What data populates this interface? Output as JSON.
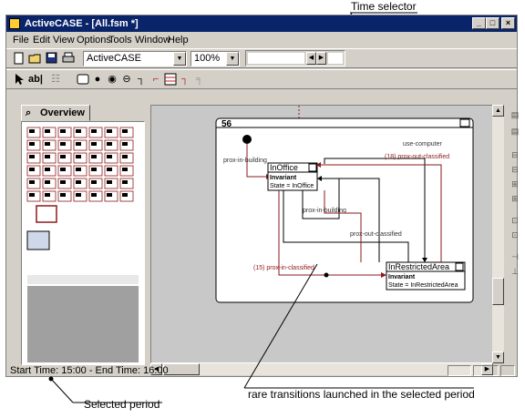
{
  "window": {
    "title": "ActiveCASE - [All.fsm *]",
    "buttons": {
      "minimize": "_",
      "maximize": "□",
      "close": "×"
    }
  },
  "menu": [
    "File",
    "Edit",
    "View",
    "Options",
    "Tools",
    "Window",
    "Help"
  ],
  "toolbar": {
    "project_combo": "ActiveCASE",
    "zoom_combo": "100%",
    "text_tool": "ab|"
  },
  "overview": {
    "tab_label": "Overview"
  },
  "statusbar": {
    "text": "Start Time: 15:00 - End Time: 16:00"
  },
  "diagram": {
    "frame_number": "56",
    "states": [
      {
        "name": "InOffice",
        "invariant_label": "Invariant",
        "invariant": "State = InOffice"
      },
      {
        "name": "InRestrictedArea",
        "invariant_label": "Invariant",
        "invariant": "State = InRestrictedArea"
      }
    ],
    "transitions": {
      "t1": "prox-in-building",
      "t2": "use-computer",
      "t3": "(18) prox-out-classified",
      "t4": "prox-in-building",
      "t5": "prox-out-classified",
      "t6": "(15) prox-in-classified"
    }
  },
  "annotations": {
    "time_selector": "Time selector",
    "selected_period": "Selected period",
    "rare_transitions": "rare transitions launched in the selected period"
  },
  "colors": {
    "titlebar": "#0a246a",
    "rare_transition": "#8b1a1a",
    "window_face": "#d4d0c8"
  }
}
